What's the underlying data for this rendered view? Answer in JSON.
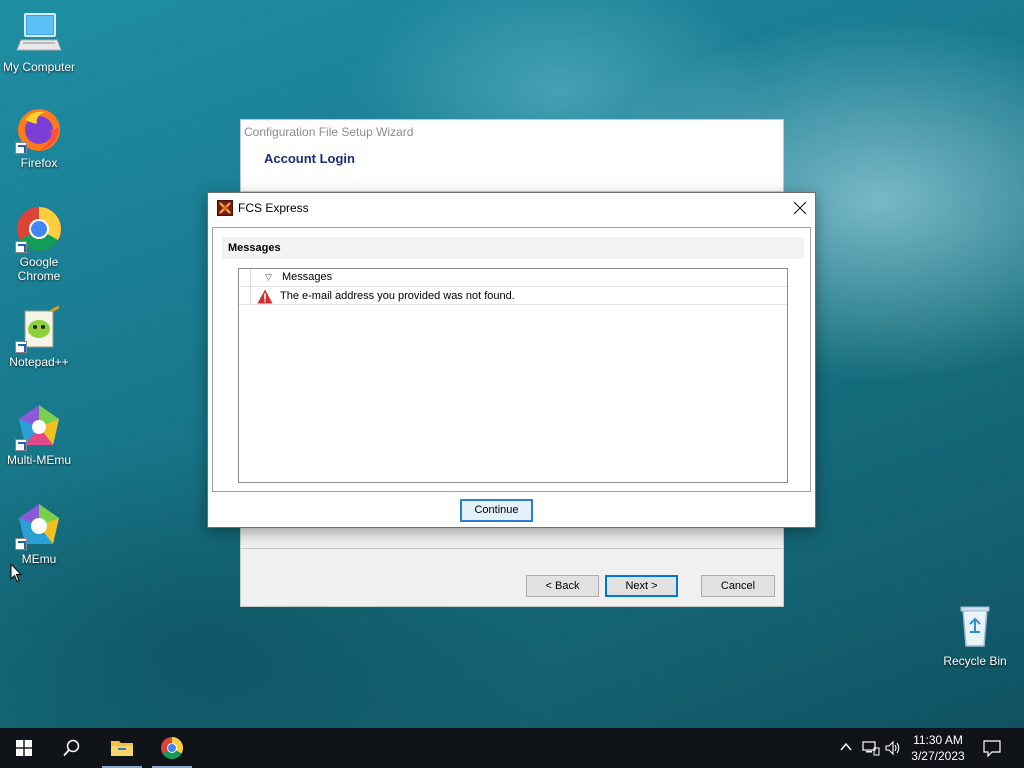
{
  "desktop": {
    "icons": [
      {
        "label": "My Computer"
      },
      {
        "label": "Firefox"
      },
      {
        "label": "Google Chrome"
      },
      {
        "label": "Notepad++"
      },
      {
        "label": "Multi-MEmu"
      },
      {
        "label": "MEmu"
      }
    ],
    "recycle_bin_label": "Recycle Bin"
  },
  "wizard": {
    "title": "Configuration File Setup Wizard",
    "step_title": "Account Login",
    "back_label": "< Back",
    "next_label": "Next >",
    "cancel_label": "Cancel"
  },
  "dialog": {
    "title": "FCS Express",
    "section_header": "Messages",
    "tree_header": "Messages",
    "message_text": "The e-mail address you provided was not found.",
    "continue_label": "Continue"
  },
  "taskbar": {
    "time": "11:30 AM",
    "date": "3/27/2023",
    "pinned": [
      "file-explorer-icon",
      "chrome-icon"
    ]
  },
  "colors": {
    "accent": "#0078d7",
    "wizard_step_title": "#1a2a80",
    "warning_red": "#d32f2f"
  }
}
